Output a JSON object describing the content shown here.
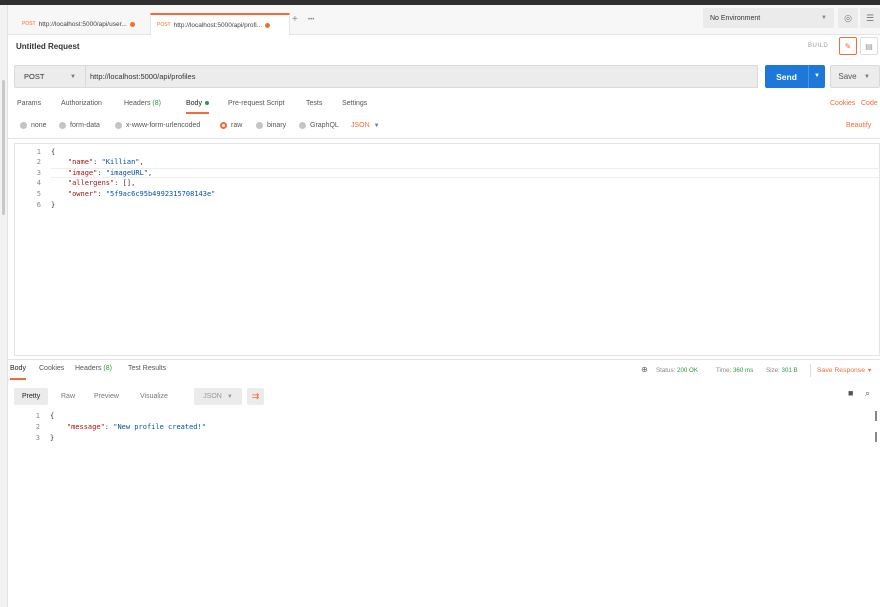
{
  "tabs": [
    {
      "method": "POST",
      "url": "http://localhost:5000/api/user...",
      "unsaved": true
    },
    {
      "method": "POST",
      "url": "http://localhost:5000/api/profi...",
      "unsaved": true,
      "active": true
    }
  ],
  "tabs_actions": {
    "add": "+",
    "more": "•••"
  },
  "environment": {
    "selected": "No Environment",
    "eye_icon": "eye-icon",
    "settings_icon": "sliders-icon"
  },
  "request": {
    "title": "Untitled Request",
    "build_label": "BUILD",
    "method": "POST",
    "url": "http://localhost:5000/api/profiles",
    "send_label": "Send",
    "save_label": "Save"
  },
  "request_tabs": [
    {
      "label": "Params"
    },
    {
      "label": "Authorization"
    },
    {
      "label": "Headers",
      "count": "(8)"
    },
    {
      "label": "Body",
      "active": true
    },
    {
      "label": "Pre-request Script"
    },
    {
      "label": "Tests"
    },
    {
      "label": "Settings"
    }
  ],
  "request_links": {
    "cookies": "Cookies",
    "code": "Code",
    "beautify": "Beautify"
  },
  "body_options": [
    "none",
    "form-data",
    "x-www-form-urlencoded",
    "raw",
    "binary",
    "GraphQL"
  ],
  "body_selected": "raw",
  "body_format": "JSON",
  "request_body_lines": [
    {
      "n": "1",
      "text": "{"
    },
    {
      "n": "2",
      "key": "\"name\"",
      "value": "\"Killian\"",
      "suffix": ","
    },
    {
      "n": "3",
      "key": "\"image\"",
      "value": "\"imageURL\"",
      "suffix": ","
    },
    {
      "n": "4",
      "key": "\"allergens\"",
      "value": "[]",
      "suffix": ","
    },
    {
      "n": "5",
      "key": "\"owner\"",
      "value": "\"5f9ac6c95b4992315708143e\"",
      "suffix": ""
    },
    {
      "n": "6",
      "text": "}"
    }
  ],
  "response_tabs": [
    {
      "label": "Body",
      "active": true
    },
    {
      "label": "Cookies"
    },
    {
      "label": "Headers",
      "count": "(8)"
    },
    {
      "label": "Test Results"
    }
  ],
  "response_status": {
    "status_label": "Status:",
    "status_value": "200 OK",
    "time_label": "Time:",
    "time_value": "360 ms",
    "size_label": "Size:",
    "size_value": "301 B",
    "save_response": "Save Response"
  },
  "response_views": [
    "Pretty",
    "Raw",
    "Preview",
    "Visualize"
  ],
  "response_format": "JSON",
  "response_body_lines": [
    {
      "n": "1",
      "text": "{"
    },
    {
      "n": "2",
      "key": "\"message\"",
      "value": "\"New profile created!\"",
      "suffix": ""
    },
    {
      "n": "3",
      "text": "}"
    }
  ],
  "colors": {
    "accent": "#f26b3a",
    "send": "#1d78d9",
    "ok": "#2a9a3e"
  }
}
